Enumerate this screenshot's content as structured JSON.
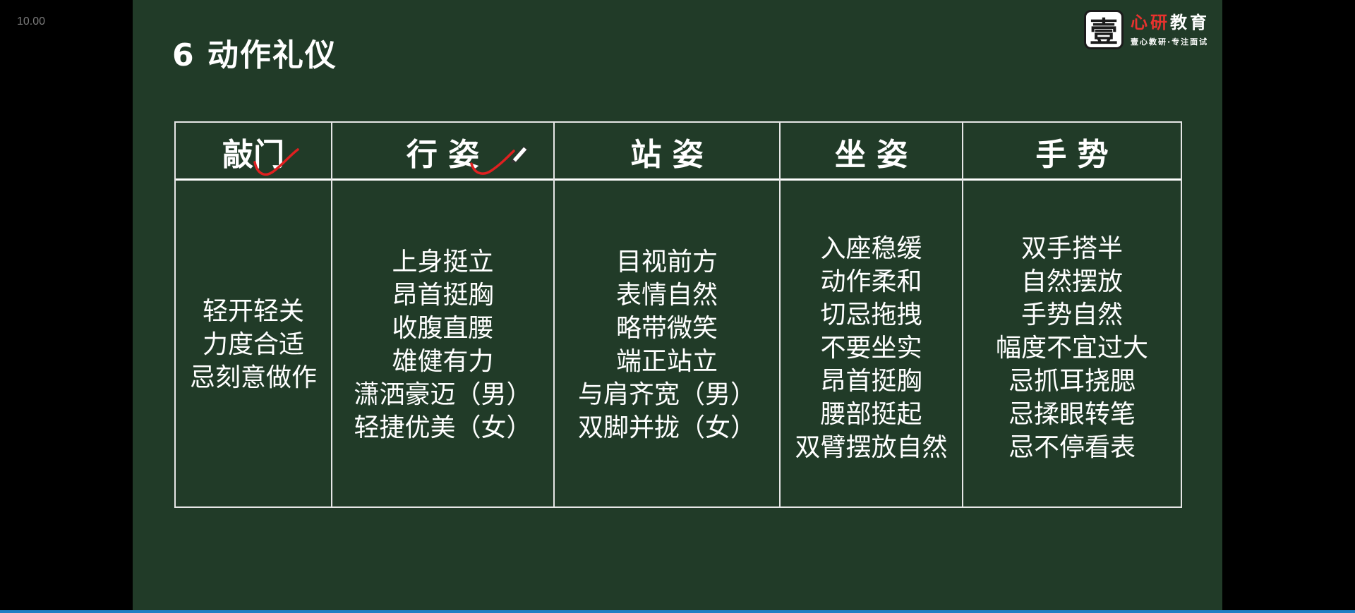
{
  "corner_label": "10.00",
  "slide": {
    "title": "6  动作礼仪",
    "logo": {
      "seal_char": "壹",
      "name_red": "心研",
      "name_white": "教育",
      "tagline": "壹心教研·专注面试"
    },
    "colors": {
      "slide_background": "#213b28",
      "text": "#ffffff",
      "annotation": "#e02020",
      "logo_red": "#e8322e"
    },
    "table": {
      "headers": [
        "敲门",
        "行 姿",
        "站 姿",
        "坐 姿",
        "手 势"
      ],
      "columns": [
        [
          "轻开轻关",
          "力度合适",
          "忌刻意做作"
        ],
        [
          "上身挺立",
          "昂首挺胸",
          "收腹直腰",
          "雄健有力",
          "潇洒豪迈（男）",
          "轻捷优美（女）"
        ],
        [
          "目视前方",
          "表情自然",
          "略带微笑",
          "端正站立",
          "与肩齐宽（男）",
          "双脚并拢（女）"
        ],
        [
          "入座稳缓",
          "动作柔和",
          "切忌拖拽",
          "不要坐实",
          "昂首挺胸",
          "腰部挺起",
          "双臂摆放自然"
        ],
        [
          "双手搭半",
          "自然摆放",
          "手势自然",
          "幅度不宜过大",
          "忌抓耳挠腮",
          "忌揉眼转笔",
          "忌不停看表"
        ]
      ]
    }
  }
}
